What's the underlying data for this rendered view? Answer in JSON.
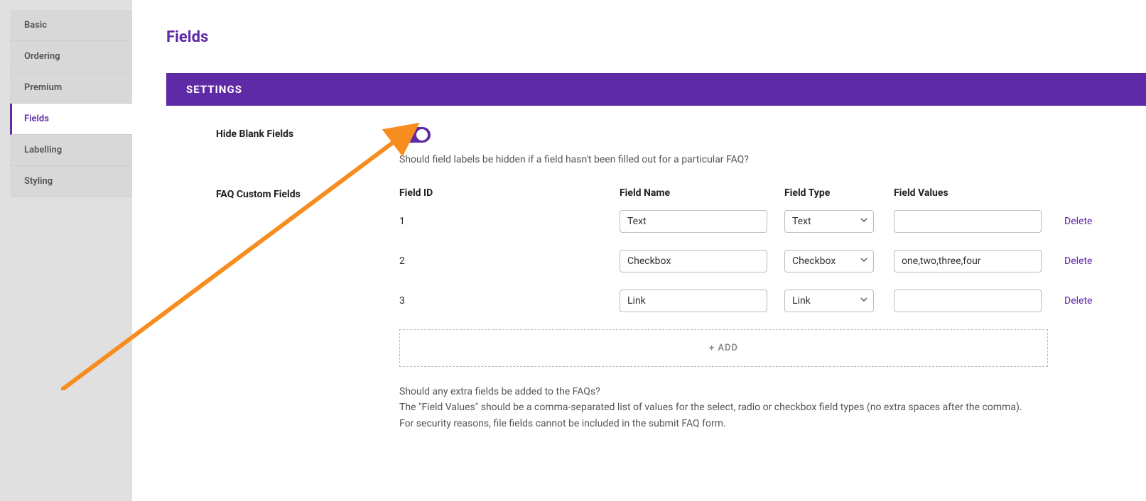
{
  "sidebar": {
    "items": [
      {
        "label": "Basic"
      },
      {
        "label": "Ordering"
      },
      {
        "label": "Premium"
      },
      {
        "label": "Fields"
      },
      {
        "label": "Labelling"
      },
      {
        "label": "Styling"
      }
    ]
  },
  "page": {
    "title": "Fields"
  },
  "settings": {
    "header": "SETTINGS",
    "hide_blank": {
      "label": "Hide Blank Fields",
      "help": "Should field labels be hidden if a field hasn't been filled out for a particular FAQ?"
    },
    "custom_fields": {
      "label": "FAQ Custom Fields",
      "headers": {
        "id": "Field ID",
        "name": "Field Name",
        "type": "Field Type",
        "values": "Field Values"
      },
      "rows": [
        {
          "id": "1",
          "name": "Text",
          "type": "Text",
          "values": ""
        },
        {
          "id": "2",
          "name": "Checkbox",
          "type": "Checkbox",
          "values": "one,two,three,four"
        },
        {
          "id": "3",
          "name": "Link",
          "type": "Link",
          "values": ""
        }
      ],
      "add_label": "+ ADD",
      "delete_label": "Delete",
      "description_1": "Should any extra fields be added to the FAQs?",
      "description_2": "The \"Field Values\" should be a comma-separated list of values for the select, radio or checkbox field types (no extra spaces after the comma).",
      "description_3": "For security reasons, file fields cannot be included in the submit FAQ form."
    }
  },
  "colors": {
    "accent": "#5e2aa5",
    "arrow": "#f78c1f"
  }
}
